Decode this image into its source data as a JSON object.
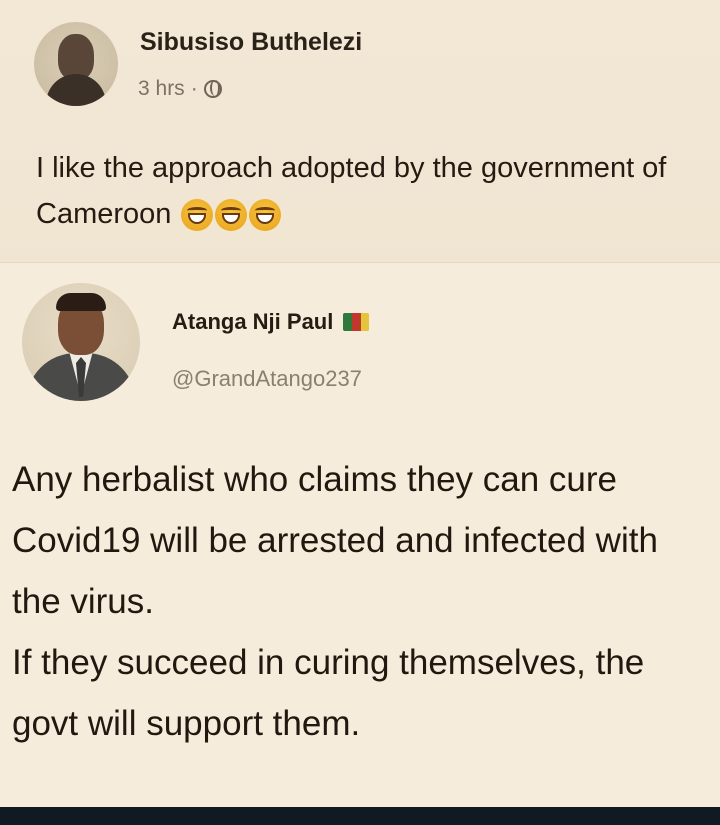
{
  "facebook_post": {
    "author": "Sibusiso Buthelezi",
    "time": "3 hrs",
    "separator": "·",
    "privacy_icon": "globe-icon",
    "text": "I like the approach adopted by the government of Cameroon",
    "emojis": [
      "laugh-emoji-icon",
      "laugh-emoji-icon",
      "laugh-emoji-icon"
    ]
  },
  "tweet": {
    "author": "Atanga Nji Paul",
    "flag_icon": "cameroon-flag-icon",
    "handle": "@GrandAtango237",
    "paragraphs": [
      "Any herbalist who claims they can cure Covid19 will be arrested and infected with the virus.",
      "If they succeed in curing themselves, the govt will support them."
    ]
  },
  "colors": {
    "background": "#efe3cf",
    "text": "#251b12",
    "muted": "#7d7263",
    "flag_green": "#2f7a3a",
    "flag_red": "#c0382b",
    "flag_yellow": "#e5c33a",
    "bottom_bar": "#101a22"
  }
}
